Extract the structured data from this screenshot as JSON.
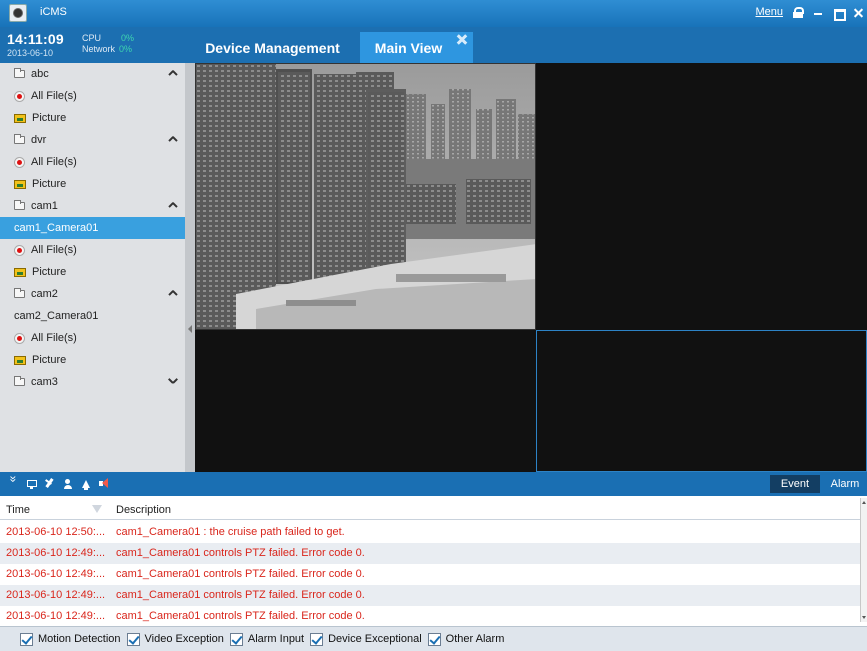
{
  "app": {
    "title": "iCMS",
    "menu_label": "Menu"
  },
  "status": {
    "time": "14:11:09",
    "date": "2013-06-10",
    "cpu_label": "CPU",
    "cpu_value": "0%",
    "network_label": "Network",
    "network_value": "0%"
  },
  "tabs": [
    {
      "label": "Device Management"
    },
    {
      "label": "Main View"
    }
  ],
  "sidebar": {
    "items": [
      {
        "label": "abc",
        "icon": "folder-icon",
        "expand": "up"
      },
      {
        "label": "All File(s)",
        "icon": "record-icon"
      },
      {
        "label": "Picture",
        "icon": "picture-icon"
      },
      {
        "label": "dvr",
        "icon": "folder-icon",
        "expand": "up"
      },
      {
        "label": "All File(s)",
        "icon": "record-icon"
      },
      {
        "label": "Picture",
        "icon": "picture-icon"
      },
      {
        "label": "cam1",
        "icon": "folder-icon",
        "expand": "up"
      },
      {
        "label": "cam1_Camera01",
        "icon": "",
        "selected": true
      },
      {
        "label": "All File(s)",
        "icon": "record-icon"
      },
      {
        "label": "Picture",
        "icon": "picture-icon"
      },
      {
        "label": "cam2",
        "icon": "folder-icon",
        "expand": "up"
      },
      {
        "label": "cam2_Camera01",
        "icon": ""
      },
      {
        "label": "All File(s)",
        "icon": "record-icon"
      },
      {
        "label": "Picture",
        "icon": "picture-icon"
      },
      {
        "label": "cam3",
        "icon": "folder-icon",
        "expand": "down"
      }
    ]
  },
  "toolbar": {
    "icons": [
      "collapse-icon",
      "monitor-icon",
      "pin-icon",
      "user-icon",
      "bell-icon",
      "speaker-icon"
    ],
    "event_tab": "Event",
    "alarm_tab": "Alarm"
  },
  "events": {
    "columns": {
      "time": "Time",
      "description": "Description"
    },
    "rows": [
      {
        "time": "2013-06-10 12:50:...",
        "description": "cam1_Camera01 : the cruise path failed to get."
      },
      {
        "time": "2013-06-10 12:49:...",
        "description": "cam1_Camera01 controls PTZ failed. Error code 0."
      },
      {
        "time": "2013-06-10 12:49:...",
        "description": "cam1_Camera01 controls PTZ failed. Error code 0."
      },
      {
        "time": "2013-06-10 12:49:...",
        "description": "cam1_Camera01 controls PTZ failed. Error code 0."
      },
      {
        "time": "2013-06-10 12:49:...",
        "description": "cam1_Camera01 controls PTZ failed. Error code 0."
      }
    ]
  },
  "filters": [
    {
      "label": "Motion Detection",
      "checked": true
    },
    {
      "label": "Video Exception",
      "checked": true
    },
    {
      "label": "Alarm Input",
      "checked": true
    },
    {
      "label": "Device Exceptional",
      "checked": true
    },
    {
      "label": "Other Alarm",
      "checked": true
    }
  ],
  "colors": {
    "titlebar": "#1873b9",
    "header": "#1c6fb1",
    "active_tab": "#2e96e0",
    "selected_item": "#39a0df",
    "event_text": "#d9261c"
  }
}
